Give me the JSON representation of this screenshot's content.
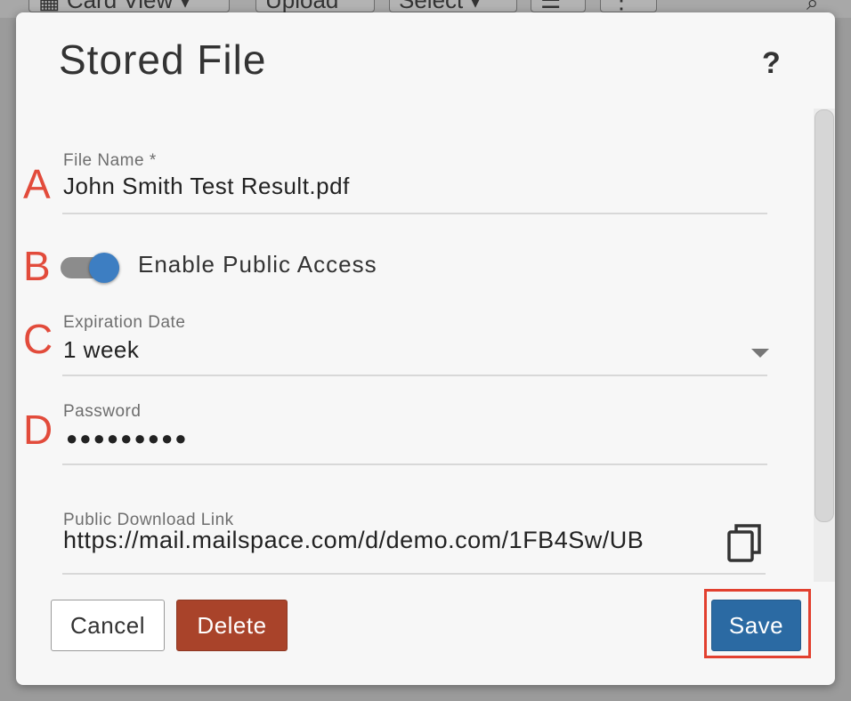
{
  "background_toolbar": {
    "card_view_label": "Card View",
    "upload_label": "Upload",
    "select_label": "Select"
  },
  "dialog": {
    "title": "Stored File",
    "help_label": "?"
  },
  "markers": {
    "a": "A",
    "b": "B",
    "c": "C",
    "d": "D"
  },
  "fields": {
    "file_name": {
      "label": "File Name *",
      "value": "John Smith Test Result.pdf"
    },
    "public_access": {
      "label": "Enable Public Access",
      "enabled": true
    },
    "expiration": {
      "label": "Expiration Date",
      "value": "1 week"
    },
    "password": {
      "label": "Password",
      "value": "●●●●●●●●●"
    },
    "download_link": {
      "label": "Public Download Link",
      "value": "https://mail.mailspace.com/d/demo.com/1FB4Sw/UB"
    }
  },
  "buttons": {
    "cancel": "Cancel",
    "delete": "Delete",
    "save": "Save"
  },
  "colors": {
    "accent_blue": "#2b6aa3",
    "delete_red": "#a9432a",
    "annotation_red": "#e24b3b",
    "toggle_knob": "#3d7ec2"
  }
}
